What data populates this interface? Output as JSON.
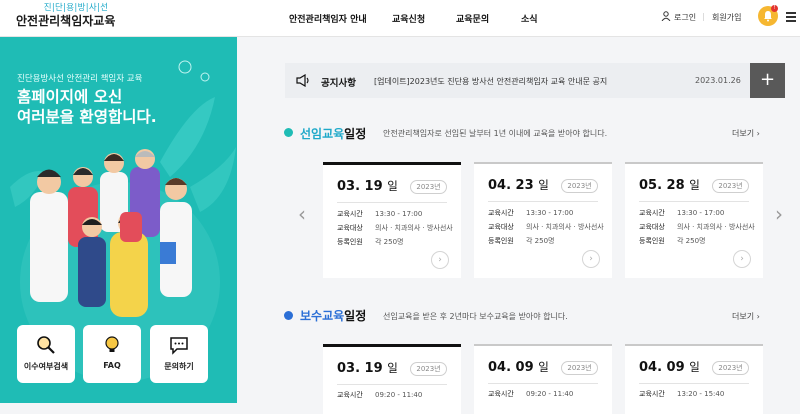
{
  "header": {
    "logo_sub": "진|단|용|방|사|선",
    "logo_main": "안전관리책임자교육",
    "nav": [
      "안전관리책임자 안내",
      "교육신청",
      "교육문의",
      "소식"
    ],
    "login": "로그인",
    "signup": "회원가입",
    "bell_badge": "!",
    "accent_color": "#1fbcb5"
  },
  "hero": {
    "subtitle": "진단용방사선 안전관리 책임자 교육",
    "title_line1": "홈페이지에 오신",
    "title_line2": "여러분을 환영합니다."
  },
  "quick": [
    {
      "label": "이수여부검색",
      "icon": "magnifier-icon"
    },
    {
      "label": "FAQ",
      "icon": "lightbulb-icon"
    },
    {
      "label": "문의하기",
      "icon": "chat-bubble-icon"
    }
  ],
  "notice": {
    "label": "공지사항",
    "text": "[업데이트]2023년도 진단용 방사선 안전관리책임자 교육 안내문 공지",
    "date": "2023.01.26",
    "plus": "+"
  },
  "section1": {
    "title_a": "선임교육",
    "title_b": "일정",
    "desc": "안전관리책임자로 선임된 날부터 1년 이내에 교육을 받아야 합니다.",
    "more": "더보기 ›",
    "cards": [
      {
        "month_day": "03. 19",
        "dow": "일",
        "year": "2023년",
        "time_k": "교육시간",
        "time_v": "13:30 - 17:00",
        "target_k": "교육대상",
        "target_v": "의사 · 치과의사 · 방사선사",
        "cap_k": "등록인원",
        "cap_v": "각 250명"
      },
      {
        "month_day": "04. 23",
        "dow": "일",
        "year": "2023년",
        "time_k": "교육시간",
        "time_v": "13:30 - 17:00",
        "target_k": "교육대상",
        "target_v": "의사 · 치과의사 · 방사선사",
        "cap_k": "등록인원",
        "cap_v": "각 250명"
      },
      {
        "month_day": "05. 28",
        "dow": "일",
        "year": "2023년",
        "time_k": "교육시간",
        "time_v": "13:30 - 17:00",
        "target_k": "교육대상",
        "target_v": "의사 · 치과의사 · 방사선사",
        "cap_k": "등록인원",
        "cap_v": "각 250명"
      }
    ]
  },
  "section2": {
    "title_a": "보수교육",
    "title_b": "일정",
    "desc": "선임교육을 받은 후 2년마다 보수교육을 받아야 합니다.",
    "more": "더보기 ›",
    "cards": [
      {
        "month_day": "03. 19",
        "dow": "일",
        "year": "2023년",
        "time_k": "교육시간",
        "time_v": "09:20 - 11:40"
      },
      {
        "month_day": "04. 09",
        "dow": "일",
        "year": "2023년",
        "time_k": "교육시간",
        "time_v": "09:20 - 11:40"
      },
      {
        "month_day": "04. 09",
        "dow": "일",
        "year": "2023년",
        "time_k": "교육시간",
        "time_v": "13:20 - 15:40"
      }
    ]
  }
}
